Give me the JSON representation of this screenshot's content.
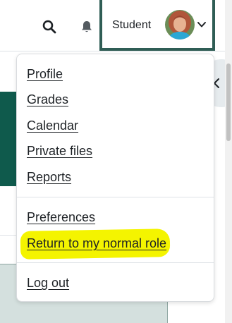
{
  "navbar": {
    "search_icon": "search-icon",
    "notification_icon": "bell-icon",
    "user_menu": {
      "name": "Student",
      "avatar_icon": "user-avatar",
      "chevron_icon": "chevron-down-icon"
    }
  },
  "drawer": {
    "close_icon": "close-icon"
  },
  "user_menu_dropdown": {
    "group1": [
      {
        "label": "Profile"
      },
      {
        "label": "Grades"
      },
      {
        "label": "Calendar"
      },
      {
        "label": "Private files"
      },
      {
        "label": "Reports"
      }
    ],
    "group2": [
      {
        "label": "Preferences"
      },
      {
        "label": "Return to my normal role",
        "highlighted": true
      }
    ],
    "group3": [
      {
        "label": "Log out"
      }
    ]
  },
  "colors": {
    "accent_border": "#2f5d55",
    "brand_green": "#0f5a4c",
    "highlight": "#f4f400",
    "lower_panel": "#d4e0de"
  }
}
